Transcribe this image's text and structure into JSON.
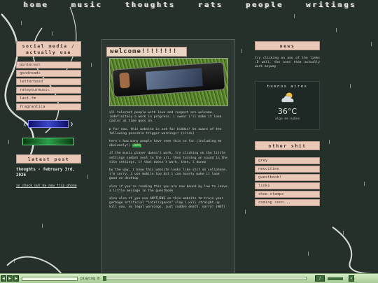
{
  "nav": [
    "home",
    "music",
    "thoughts",
    "rats",
    "people",
    "writings"
  ],
  "left": {
    "social_title": "social media / actually use",
    "links": [
      "pinterest",
      "goodreads",
      "letterboxd",
      "rateyourmusic",
      "last.fm",
      "fragrantica"
    ],
    "latest_title": "latest post",
    "post_title": "thoughts - february 3rd, 2026",
    "post_link": "so check out my new flip phone"
  },
  "center": {
    "title": "welcome!!!!!!!!",
    "paragraphs": [
      "all tolerant people with love and respect are welcome. indefinitely a work in progress. i swear i'll make it look cooler as time goes on.",
      "▶ for now, this website is not for kiddos! be aware of the following possible trigger warnings! (click)",
      "here's how many people have seen this so far (including me obviously!)",
      "if the music player doesn't work, try clicking on the little settings symbol next to the url, then turning on sound in the site settings. if that doesn't work, then, i dunno",
      "by the way, i know this website looks like shit on cellphone. i'm sorry, i use mobile too but i can barely make it look good on desktop",
      "also if you're reading this you are now bound by law to leave a little message in the guestbook",
      "also also if you use ANYTHING on this website to train your garbage artificial \"intelligence\" slop i will straight up kill you. no legal warnings, just sudden death. sorry! (NOT)"
    ],
    "counter": "2091"
  },
  "right": {
    "news_title": "news",
    "news_text": "try clicking on one of the links :D well, the ones that actually work anyway",
    "weather": {
      "city": "buenos aires",
      "temp": "36°C",
      "desc": "algo de nubes"
    },
    "other_title": "other shit",
    "other_links": [
      "grey",
      "neocities",
      "guestbook!",
      "links",
      "show stamps",
      "coming soon..."
    ]
  },
  "player": {
    "status": "playing",
    "track": "8"
  },
  "colors": {
    "background": "#26302a",
    "panel": "#e9c8b8",
    "player": "#b8d8a8"
  }
}
